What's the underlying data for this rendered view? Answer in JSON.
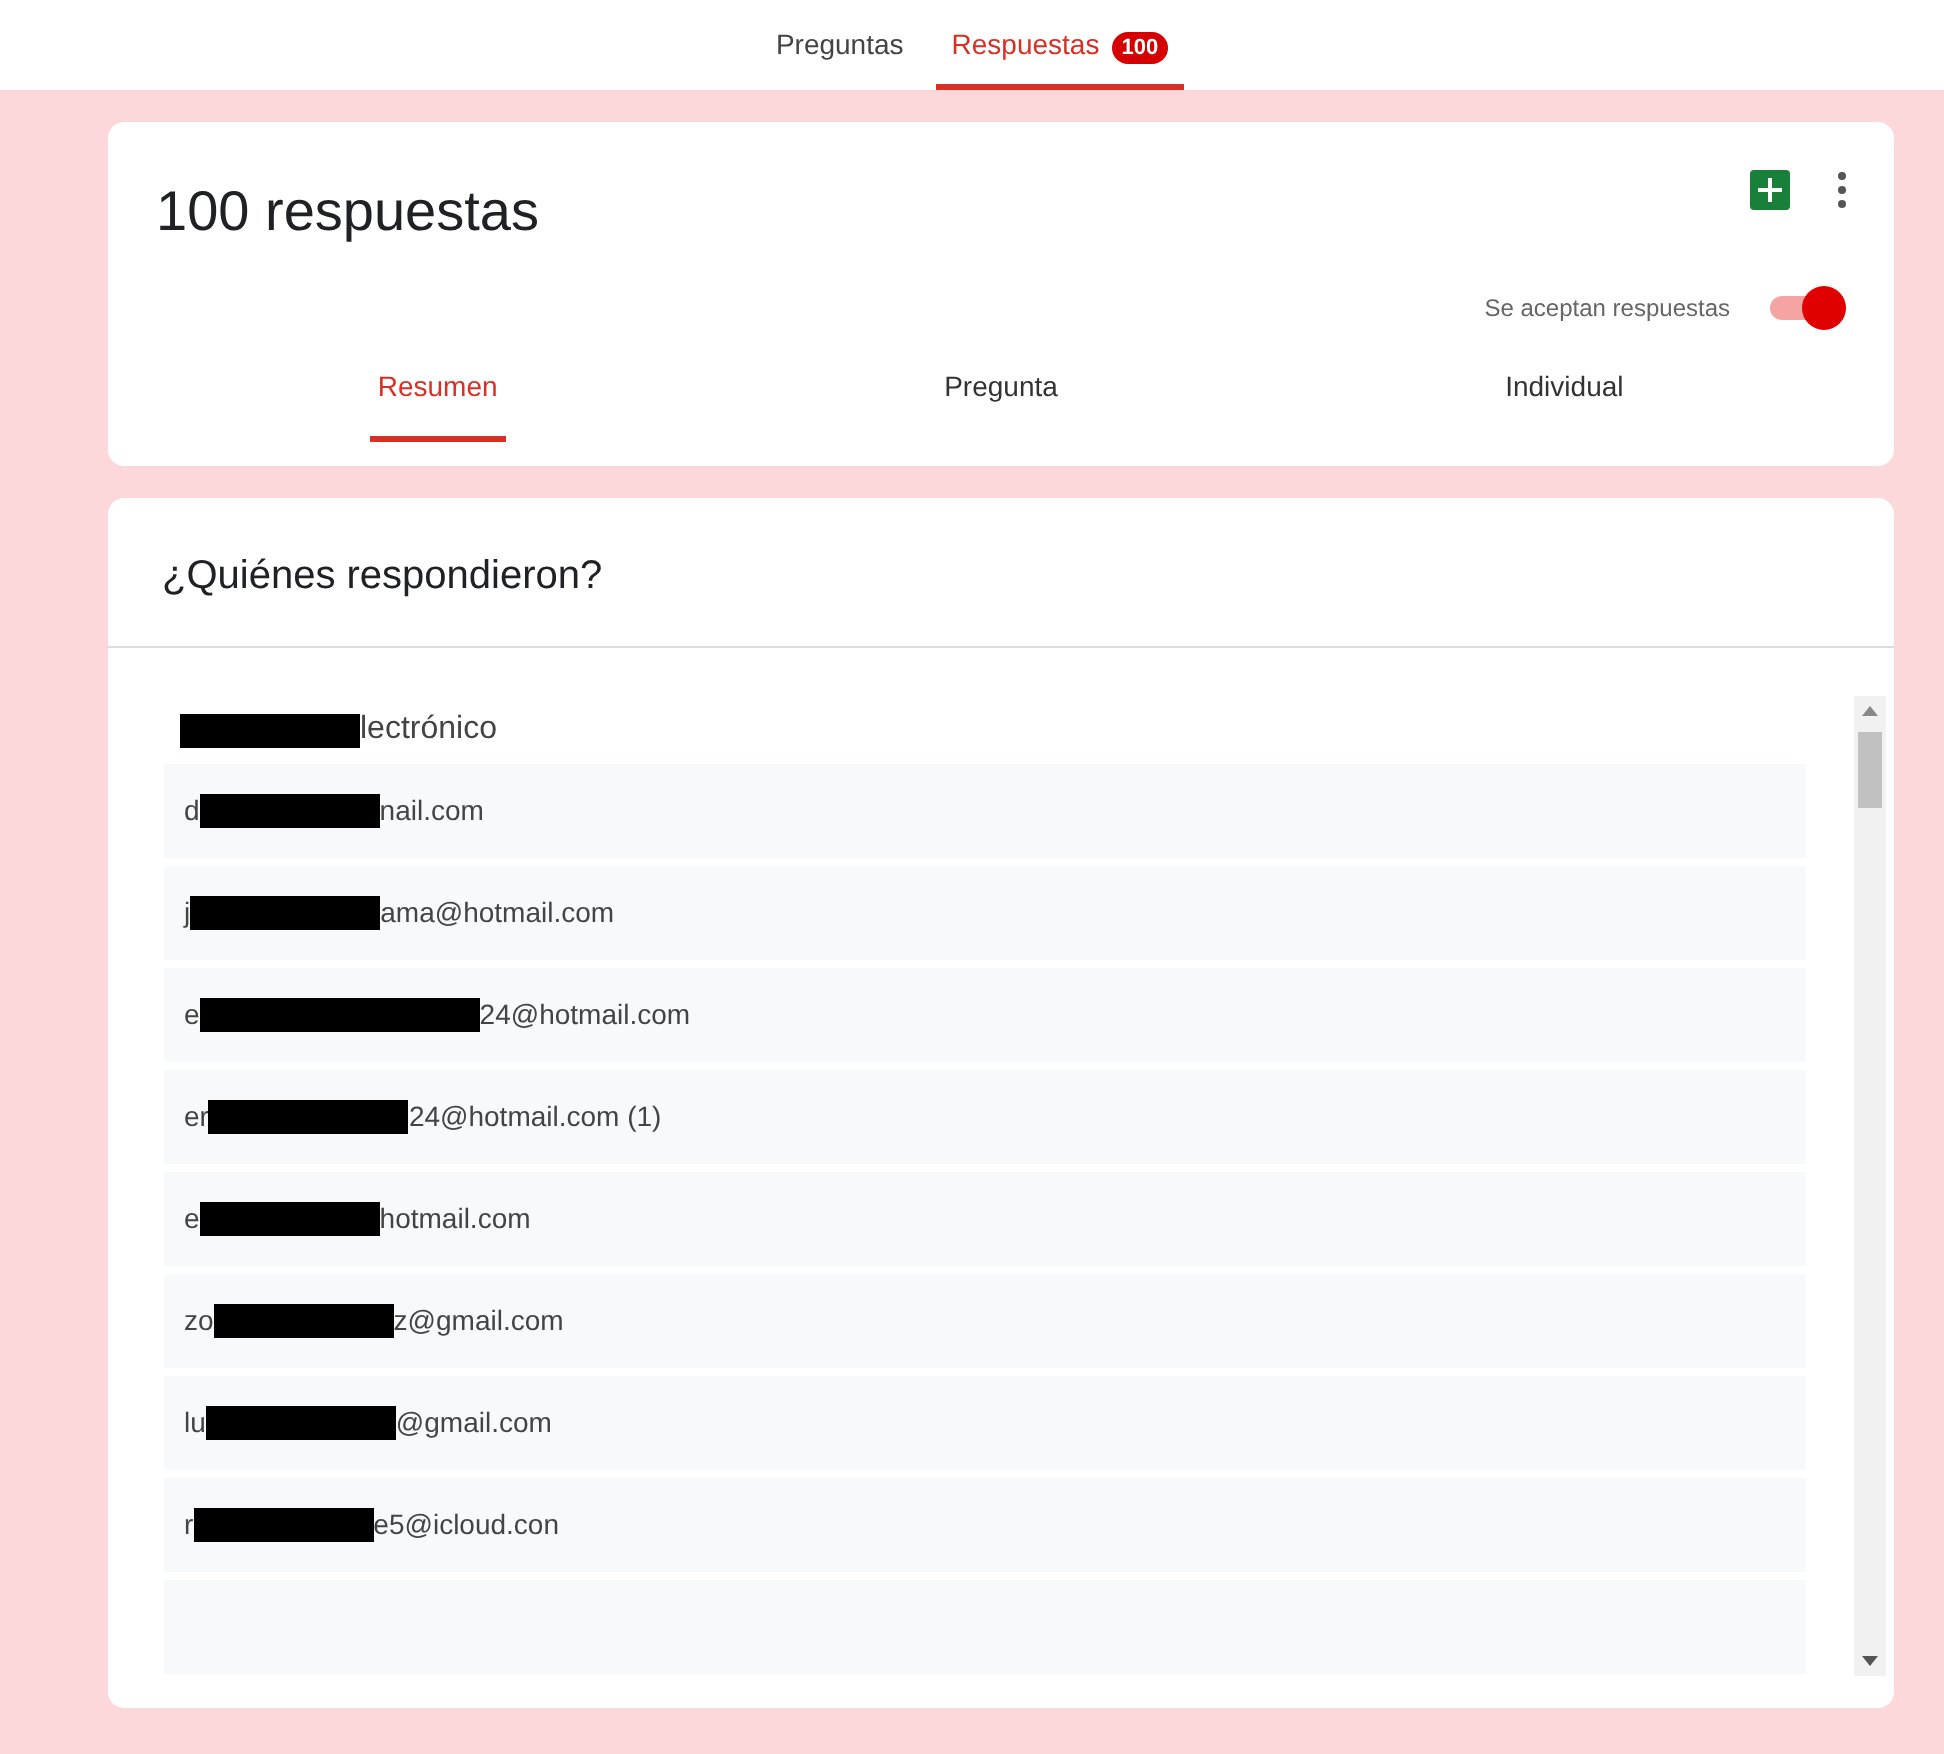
{
  "top_tabs": [
    {
      "label": "Preguntas",
      "selected": false
    },
    {
      "label": "Respuestas",
      "selected": true,
      "badge": "100"
    }
  ],
  "summary": {
    "title": "100 respuestas",
    "accepting_label": "Se aceptan respuestas",
    "accepting": true
  },
  "view_tabs": [
    {
      "label": "Resumen",
      "selected": true
    },
    {
      "label": "Pregunta",
      "selected": false
    },
    {
      "label": "Individual",
      "selected": false
    }
  ],
  "respondents": {
    "title": "¿Quiénes respondieron?",
    "header": {
      "after": "lectrónico"
    },
    "rows": [
      {
        "before": "d",
        "after": "nail.com"
      },
      {
        "before": "j",
        "after": "ama@hotmail.com"
      },
      {
        "before": "e",
        "after": "24@hotmail.com"
      },
      {
        "before": "er",
        "after": "24@hotmail.com (1)"
      },
      {
        "before": "e",
        "after": "hotmail.com"
      },
      {
        "before": "zo",
        "after": "z@gmail.com"
      },
      {
        "before": "lu",
        "after": "@gmail.com"
      },
      {
        "before": "r",
        "after": "e5@icloud.con"
      }
    ]
  }
}
